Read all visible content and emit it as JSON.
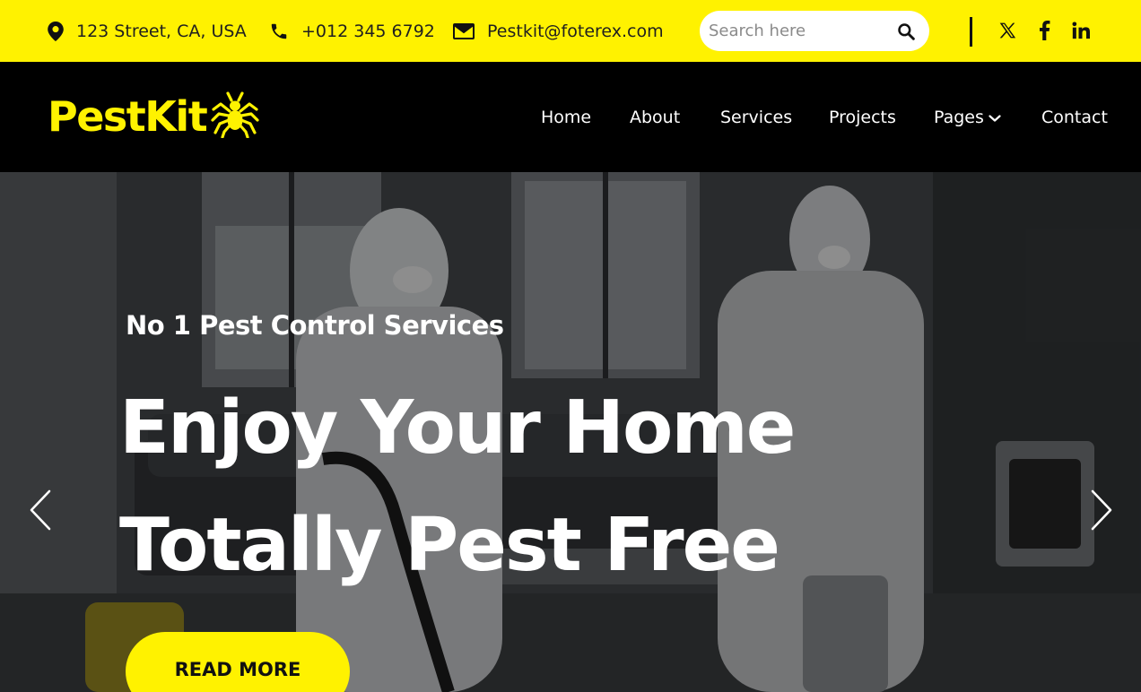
{
  "topbar": {
    "address": "123 Street, CA, USA",
    "phone": "+012 345 6792",
    "email": "Pestkit@foterex.com",
    "search": {
      "placeholder": "Search here",
      "value": ""
    },
    "social": [
      "x-icon",
      "facebook-icon",
      "linkedin-icon"
    ]
  },
  "brand": {
    "name": "PestKit"
  },
  "nav": {
    "items": [
      {
        "label": "Home"
      },
      {
        "label": "About"
      },
      {
        "label": "Services"
      },
      {
        "label": "Projects"
      },
      {
        "label": "Pages"
      },
      {
        "label": "Contact"
      }
    ]
  },
  "hero": {
    "subtitle": "No 1 Pest Control Services",
    "title": "Enjoy Your Home Totally Pest Free",
    "cta": "READ MORE"
  },
  "colors": {
    "accent": "#fff200",
    "nav_bg": "#000000",
    "text_dark": "#1f1f1f"
  }
}
